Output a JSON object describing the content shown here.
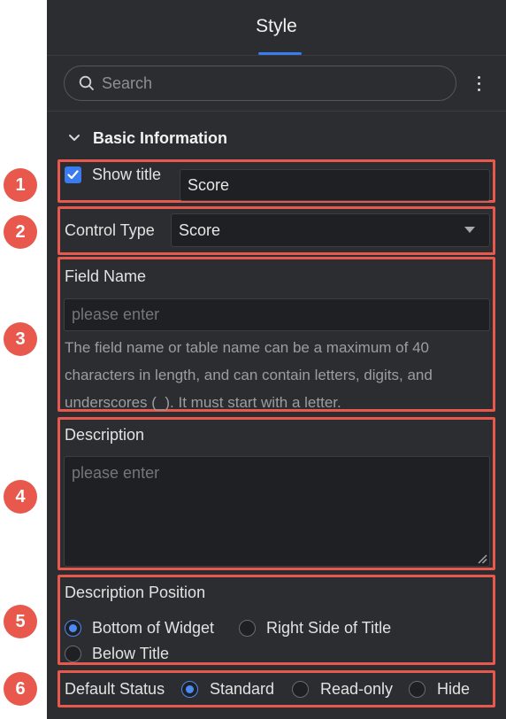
{
  "header": {
    "tab_label": "Style"
  },
  "search": {
    "placeholder": "Search"
  },
  "section": {
    "title": "Basic Information"
  },
  "show_title": {
    "label": "Show title",
    "value": "Score",
    "checked": true
  },
  "control_type": {
    "label": "Control Type",
    "value": "Score"
  },
  "field_name": {
    "label": "Field Name",
    "placeholder": "please enter",
    "help_lines": [
      "The field name or table name can be a maximum of 40",
      "characters in length, and can contain letters, digits, and",
      "underscores (_). It must start with a letter."
    ]
  },
  "description": {
    "label": "Description",
    "placeholder": "please enter"
  },
  "description_position": {
    "label": "Description Position",
    "options": [
      "Bottom of Widget",
      "Right Side of Title",
      "Below Title"
    ],
    "selected": "Bottom of Widget"
  },
  "default_status": {
    "label": "Default Status",
    "options": [
      "Standard",
      "Read-only",
      "Hide"
    ],
    "selected": "Standard"
  },
  "annotations": [
    "1",
    "2",
    "3",
    "4",
    "5",
    "6"
  ],
  "colors": {
    "panel_bg": "#2c2d30",
    "accent": "#3b7bf0",
    "annotation_red": "#e8584d",
    "input_bg": "#1f2023"
  }
}
